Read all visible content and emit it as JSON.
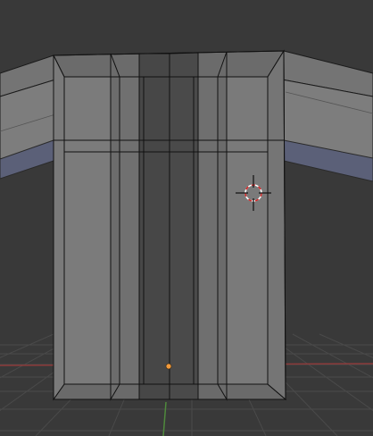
{
  "viewport": {
    "colors": {
      "background": "#393939",
      "grid": "#4a4a4a",
      "x_axis": "#8c3b3b",
      "y_axis": "#4f8a3c",
      "face_light": "#7a7a7a",
      "face_mid": "#6e6e6e",
      "face_dark": "#474747",
      "edge": "#1a1a1a",
      "under_face": "#5b6078",
      "cursor_red": "#d22a2a",
      "origin_dot": "#f29a3c"
    },
    "icons": {
      "cursor": "3d-cursor-icon",
      "origin": "object-origin-icon"
    }
  }
}
